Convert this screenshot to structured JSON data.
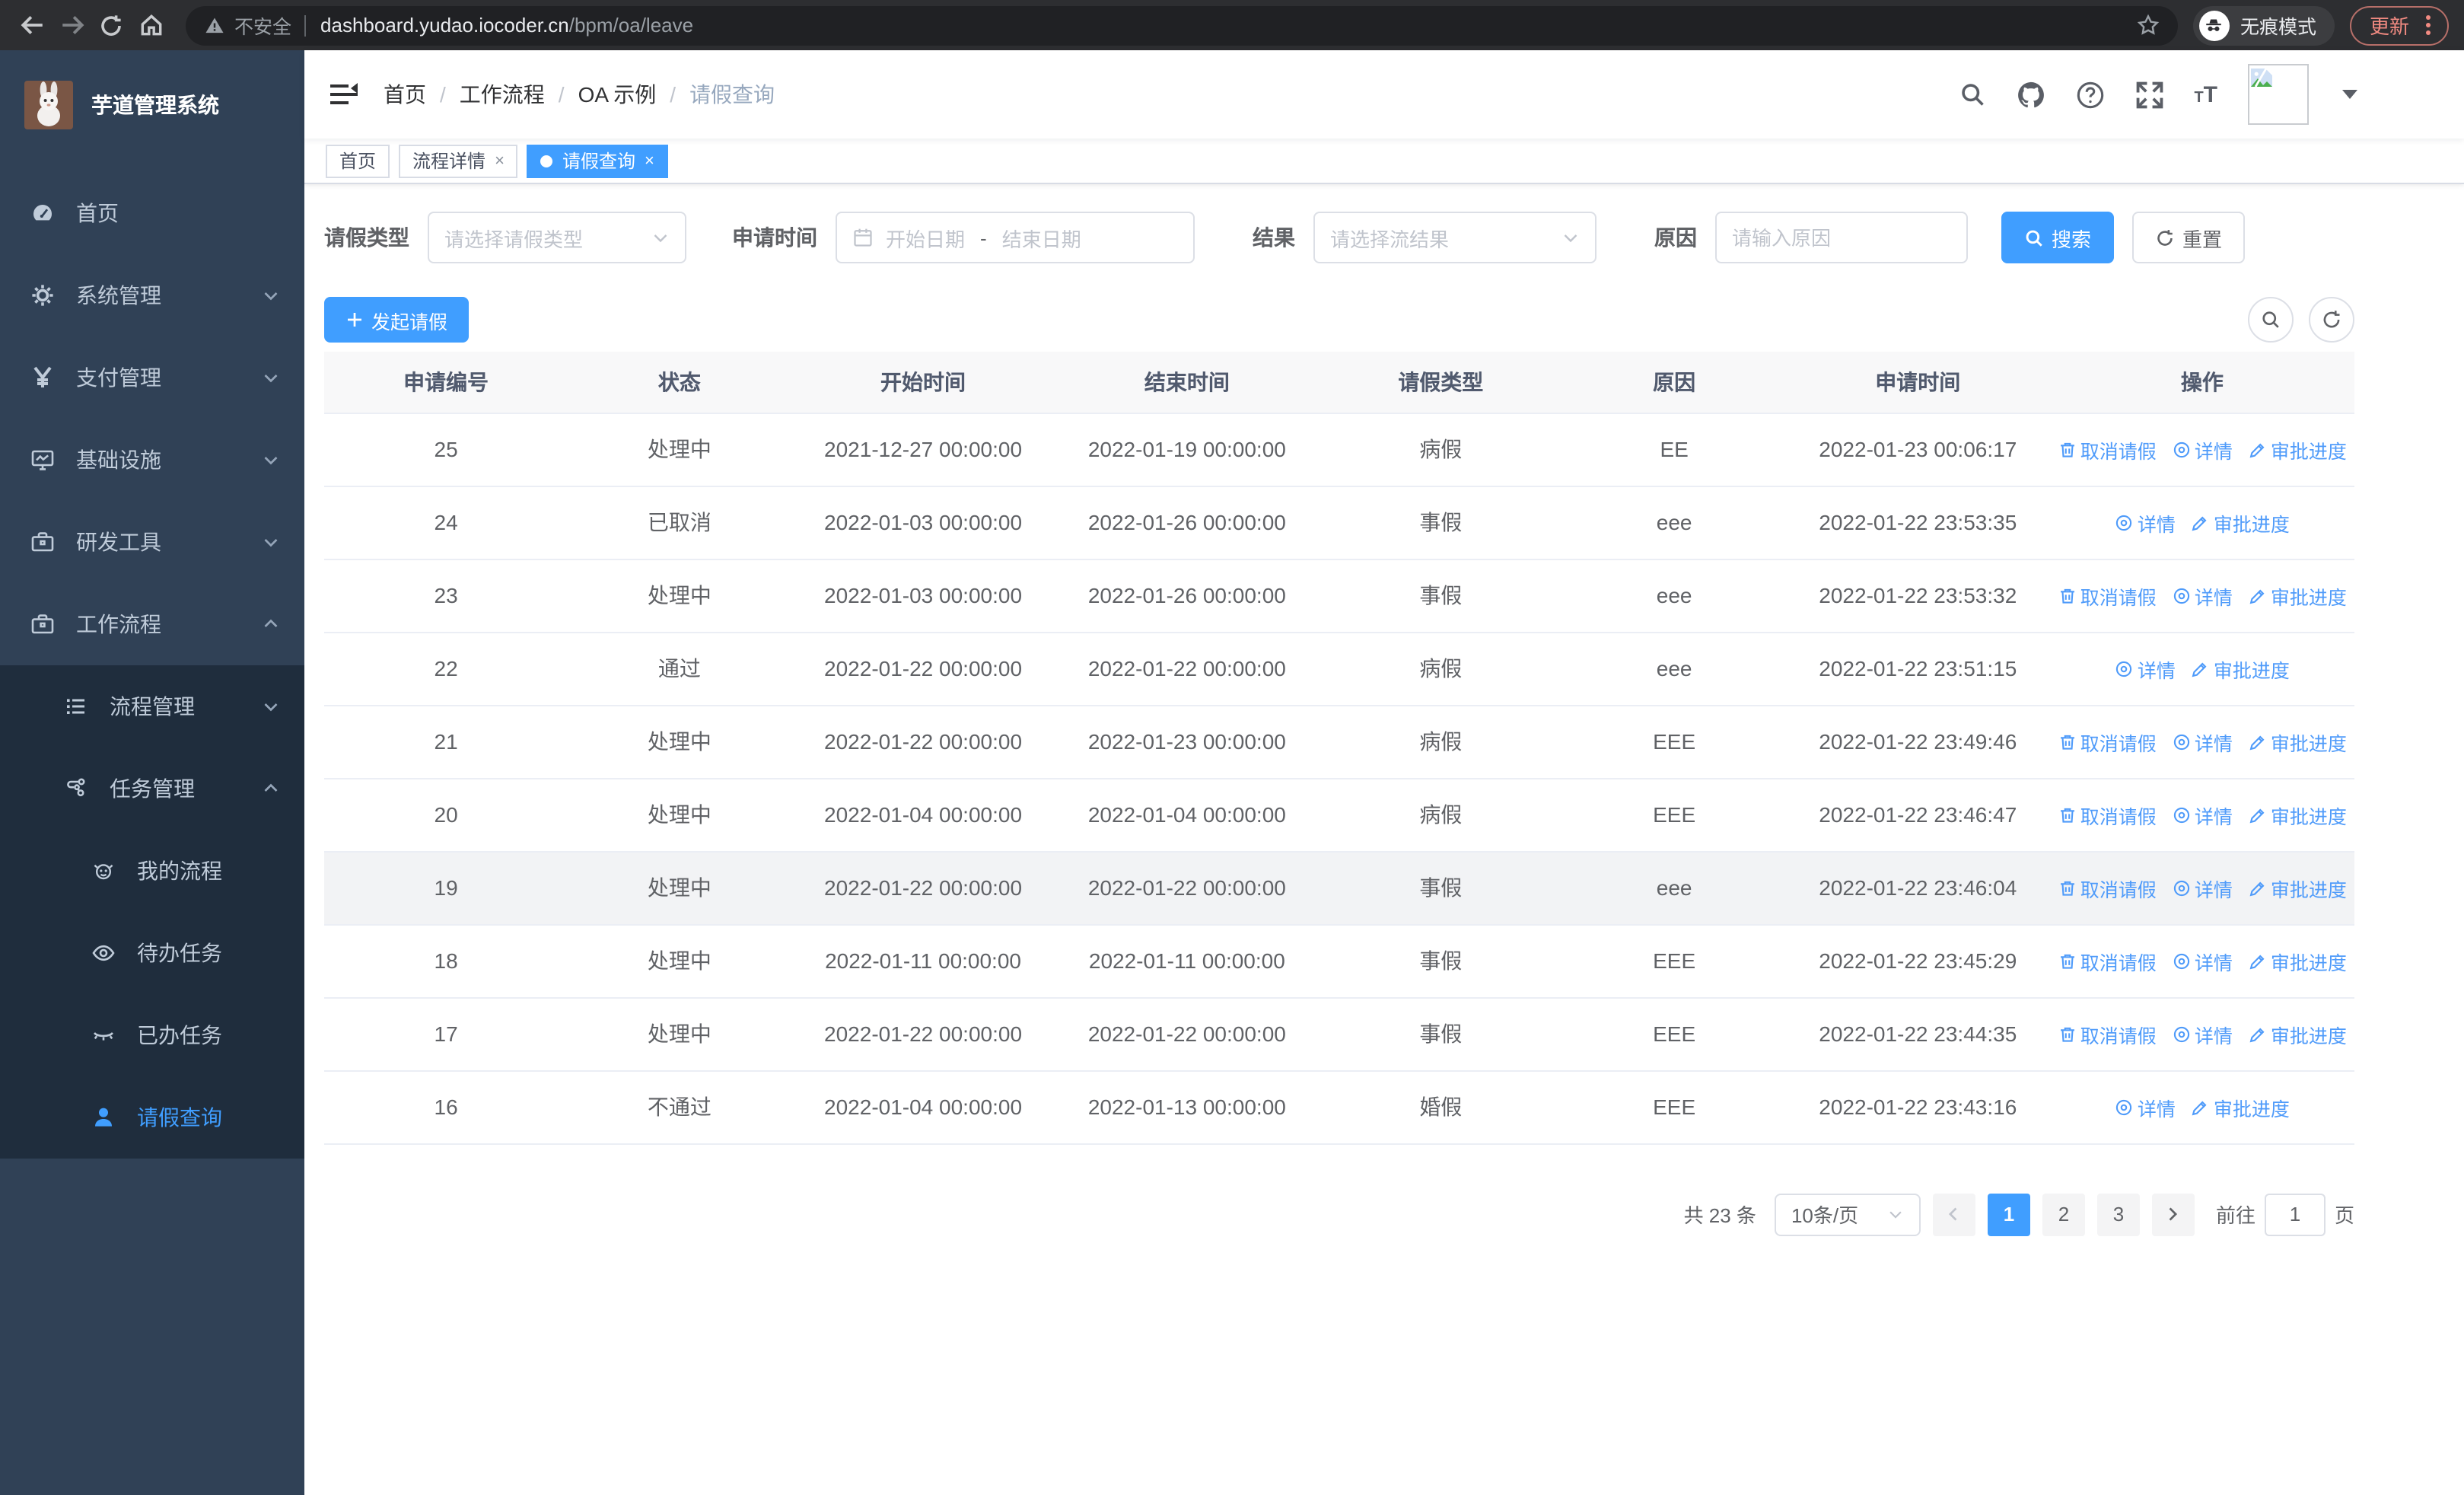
{
  "colors": {
    "accent": "#409eff",
    "sidebar_bg": "#304156",
    "submenu_bg": "#1f2d3d",
    "sidebar_text": "#bfcbd9",
    "update_pill": "#f28b82",
    "table_header_bg": "#f8f8f9"
  },
  "browser": {
    "security_label": "不安全",
    "url_host": "dashboard.yudao.iocoder.cn",
    "url_path": "/bpm/oa/leave",
    "incognito_label": "无痕模式",
    "update_label": "更新"
  },
  "sidebar": {
    "title": "芋道管理系统",
    "items": [
      {
        "label": "首页"
      },
      {
        "label": "系统管理"
      },
      {
        "label": "支付管理"
      },
      {
        "label": "基础设施"
      },
      {
        "label": "研发工具"
      },
      {
        "label": "工作流程"
      },
      {
        "label": "流程管理"
      },
      {
        "label": "任务管理"
      },
      {
        "label": "我的流程"
      },
      {
        "label": "待办任务"
      },
      {
        "label": "已办任务"
      },
      {
        "label": "请假查询"
      }
    ]
  },
  "breadcrumb": {
    "items": [
      "首页",
      "工作流程",
      "OA 示例",
      "请假查询"
    ],
    "separator": "/"
  },
  "tags": [
    {
      "label": "首页",
      "closable": false,
      "active": false
    },
    {
      "label": "流程详情",
      "closable": true,
      "active": false
    },
    {
      "label": "请假查询",
      "closable": true,
      "active": true
    }
  ],
  "filters": {
    "leave_type_label": "请假类型",
    "leave_type_placeholder": "请选择请假类型",
    "apply_time_label": "申请时间",
    "date_start_placeholder": "开始日期",
    "date_separator": "-",
    "date_end_placeholder": "结束日期",
    "result_label": "结果",
    "result_placeholder": "请选择流结果",
    "reason_label": "原因",
    "reason_placeholder": "请输入原因",
    "search_label": "搜索",
    "reset_label": "重置"
  },
  "toolbar": {
    "create_label": "发起请假"
  },
  "table": {
    "headers": [
      "申请编号",
      "状态",
      "开始时间",
      "结束时间",
      "请假类型",
      "原因",
      "申请时间",
      "操作"
    ],
    "rows": [
      {
        "id": "25",
        "status": "处理中",
        "start": "2021-12-27 00:00:00",
        "end": "2022-01-19 00:00:00",
        "type": "病假",
        "reason": "EE",
        "apply": "2022-01-23 00:06:17",
        "cancelable": true,
        "highlighted": false
      },
      {
        "id": "24",
        "status": "已取消",
        "start": "2022-01-03 00:00:00",
        "end": "2022-01-26 00:00:00",
        "type": "事假",
        "reason": "eee",
        "apply": "2022-01-22 23:53:35",
        "cancelable": false,
        "highlighted": false
      },
      {
        "id": "23",
        "status": "处理中",
        "start": "2022-01-03 00:00:00",
        "end": "2022-01-26 00:00:00",
        "type": "事假",
        "reason": "eee",
        "apply": "2022-01-22 23:53:32",
        "cancelable": true,
        "highlighted": false
      },
      {
        "id": "22",
        "status": "通过",
        "start": "2022-01-22 00:00:00",
        "end": "2022-01-22 00:00:00",
        "type": "病假",
        "reason": "eee",
        "apply": "2022-01-22 23:51:15",
        "cancelable": false,
        "highlighted": false
      },
      {
        "id": "21",
        "status": "处理中",
        "start": "2022-01-22 00:00:00",
        "end": "2022-01-23 00:00:00",
        "type": "病假",
        "reason": "EEE",
        "apply": "2022-01-22 23:49:46",
        "cancelable": true,
        "highlighted": false
      },
      {
        "id": "20",
        "status": "处理中",
        "start": "2022-01-04 00:00:00",
        "end": "2022-01-04 00:00:00",
        "type": "病假",
        "reason": "EEE",
        "apply": "2022-01-22 23:46:47",
        "cancelable": true,
        "highlighted": false
      },
      {
        "id": "19",
        "status": "处理中",
        "start": "2022-01-22 00:00:00",
        "end": "2022-01-22 00:00:00",
        "type": "事假",
        "reason": "eee",
        "apply": "2022-01-22 23:46:04",
        "cancelable": true,
        "highlighted": true
      },
      {
        "id": "18",
        "status": "处理中",
        "start": "2022-01-11 00:00:00",
        "end": "2022-01-11 00:00:00",
        "type": "事假",
        "reason": "EEE",
        "apply": "2022-01-22 23:45:29",
        "cancelable": true,
        "highlighted": false
      },
      {
        "id": "17",
        "status": "处理中",
        "start": "2022-01-22 00:00:00",
        "end": "2022-01-22 00:00:00",
        "type": "事假",
        "reason": "EEE",
        "apply": "2022-01-22 23:44:35",
        "cancelable": true,
        "highlighted": false
      },
      {
        "id": "16",
        "status": "不通过",
        "start": "2022-01-04 00:00:00",
        "end": "2022-01-13 00:00:00",
        "type": "婚假",
        "reason": "EEE",
        "apply": "2022-01-22 23:43:16",
        "cancelable": false,
        "highlighted": false
      }
    ]
  },
  "actions": {
    "cancel": "取消请假",
    "detail": "详情",
    "progress": "审批进度"
  },
  "pagination": {
    "total_label": "共 23 条",
    "page_size_value": "10条/页",
    "pages": [
      "1",
      "2",
      "3"
    ],
    "active_page": "1",
    "goto_label": "前往",
    "goto_value": "1",
    "page_unit": "页"
  }
}
